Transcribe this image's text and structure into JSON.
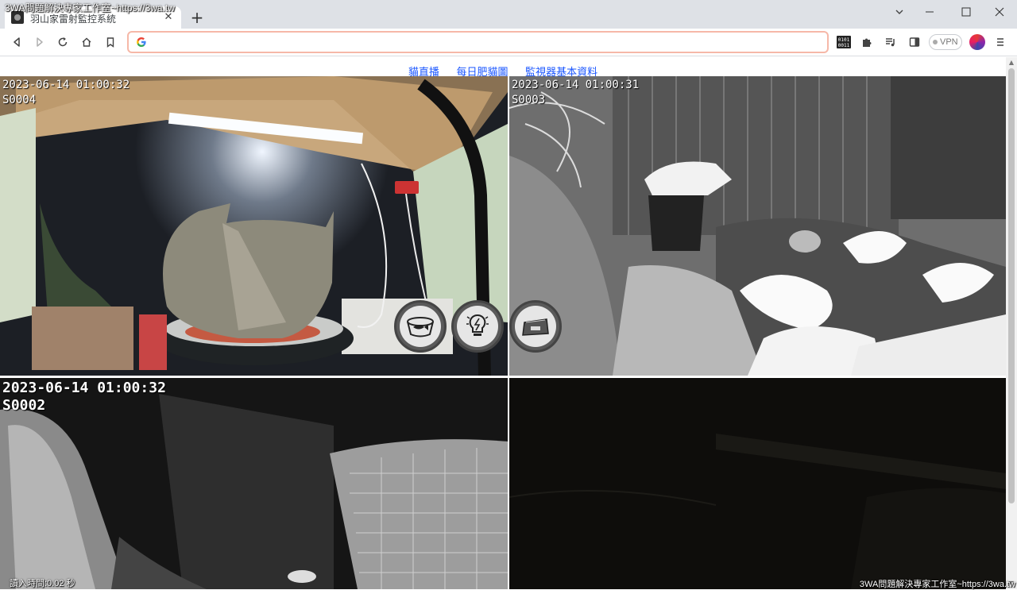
{
  "window": {
    "label": "3WA問題解決專家工作室~https://3wa.tw"
  },
  "tab": {
    "title": "羽山家雷射監控系統"
  },
  "toolbar": {
    "url": "",
    "vpn_label": "VPN"
  },
  "nav": {
    "links": [
      "貓直播",
      "每日肥貓圖",
      "監視器基本資料"
    ]
  },
  "cameras": [
    {
      "id": "cam-1",
      "timestamp": "2023-06-14 01:00:32",
      "code": "S0004"
    },
    {
      "id": "cam-2",
      "timestamp": "2023-06-14 01:00:31",
      "code": "S0003"
    },
    {
      "id": "cam-3",
      "timestamp": "2023-06-14 01:00:32",
      "code": "S0002"
    },
    {
      "id": "cam-4",
      "timestamp": "",
      "code": ""
    }
  ],
  "controls": [
    {
      "name": "feeder-bowl-icon"
    },
    {
      "name": "light-bulb-icon"
    },
    {
      "name": "scale-icon"
    }
  ],
  "status": {
    "load_time": "讀入時間:0.02 秒",
    "watermark": "3WA問題解決專家工作室~https://3wa.tw"
  }
}
